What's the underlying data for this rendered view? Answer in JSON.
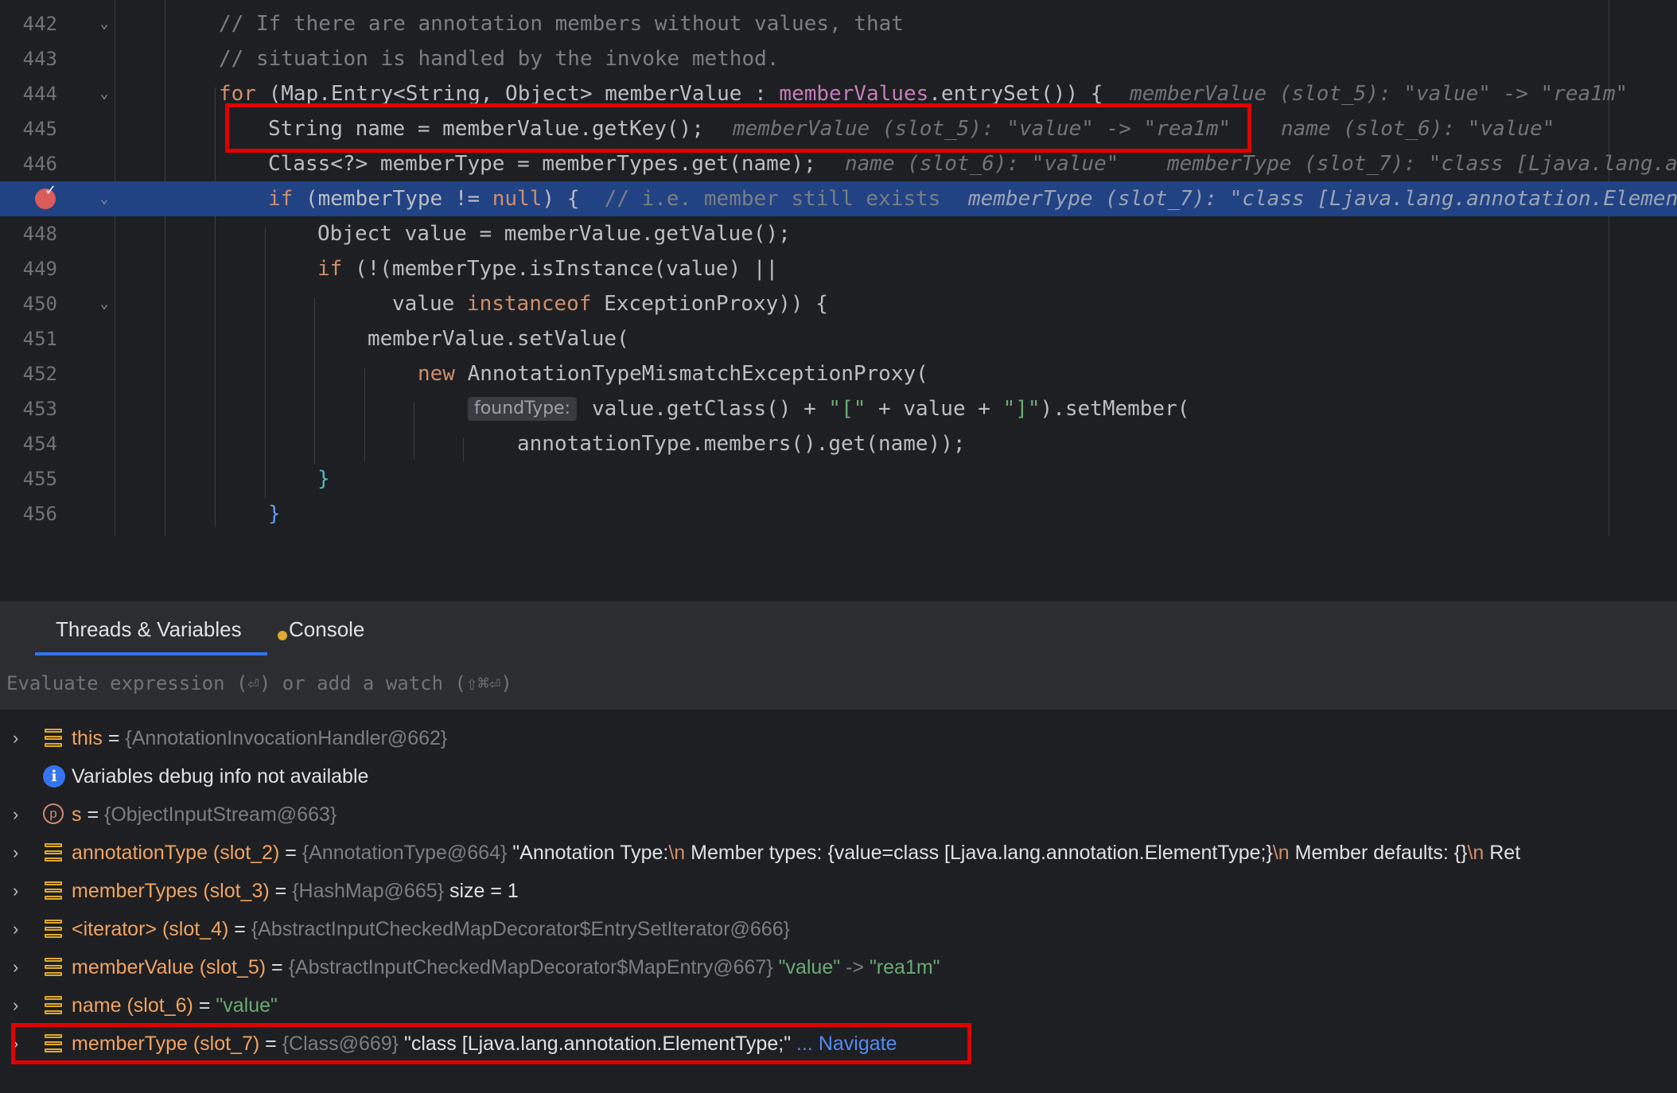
{
  "editor": {
    "lines": [
      {
        "num": "442",
        "code": "// If there are annotation members without values, that"
      },
      {
        "num": "443",
        "code": "// situation is handled by the invoke method."
      },
      {
        "num": "444",
        "code": {
          "kw_for": "for",
          "p1": " (Map.Entry<String, Object> memberValue : ",
          "field": "memberValues",
          "p2": ".entrySet()) {"
        },
        "hint": "memberValue (slot_5): \"value\" -> \"rea1m\""
      },
      {
        "num": "445",
        "code": "String name = memberValue.getKey();",
        "hint1": "memberValue (slot_5): \"value\" -> \"rea1m\"",
        "hint2": "name (slot_6): \"value\""
      },
      {
        "num": "446",
        "code": "Class<?> memberType = memberTypes.get(name);",
        "hint1": "name (slot_6): \"value\"",
        "hint2": "memberType (slot_7): \"class [Ljava.lang.a"
      },
      {
        "num": "447",
        "code": {
          "kw_if": "if",
          "p1": " (memberType != ",
          "kw_null": "null",
          "p2": ") {",
          "comment": "  // i.e. member still exists"
        },
        "hint": "memberType (slot_7): \"class [Ljava.lang.annotation.Elemen"
      },
      {
        "num": "448",
        "code": "Object value = memberValue.getValue();"
      },
      {
        "num": "449",
        "code": {
          "kw_if": "if",
          "p1": " (!(memberType.isInstance(value) ||"
        }
      },
      {
        "num": "450",
        "code": {
          "p1": "value ",
          "kw": "instanceof",
          "p2": " ExceptionProxy)) {"
        }
      },
      {
        "num": "451",
        "code": "memberValue.setValue("
      },
      {
        "num": "452",
        "code": {
          "kw": "new",
          "p1": " AnnotationTypeMismatchExceptionProxy("
        }
      },
      {
        "num": "453",
        "hint_chip": "foundType:",
        "code": {
          "p1": "value.getClass() + ",
          "s1": "\"[\"",
          "p2": " + value + ",
          "s2": "\"]\"",
          "p3": ").setMember("
        }
      },
      {
        "num": "454",
        "code": "annotationType.members().get(name));"
      },
      {
        "num": "455",
        "code": "}"
      },
      {
        "num": "456",
        "code": "}"
      }
    ]
  },
  "debug": {
    "tabs": [
      {
        "label": "Threads & Variables",
        "active": true
      },
      {
        "label": "Console",
        "active": false
      }
    ],
    "evaluate_placeholder": "Evaluate expression (⏎) or add a watch (⇧⌘⏎)",
    "variables": [
      {
        "name": "this",
        "type": "{AnnotationInvocationHandler@662}"
      },
      {
        "info": "Variables debug info not available"
      },
      {
        "name": "s",
        "type": "{ObjectInputStream@663}"
      },
      {
        "name": "annotationType (slot_2)",
        "type": "{AnnotationType@664}",
        "v1": "\"Annotation Type:",
        "nl": "\\n",
        "v2": "   Member types: {value=class [Ljava.lang.annotation.ElementType;}",
        "nl2": "\\n",
        "v3": "   Member defaults: {}",
        "nl3": "\\n",
        "v4": "   Ret"
      },
      {
        "name": "memberTypes (slot_3)",
        "type": "{HashMap@665}",
        "value": "size = 1"
      },
      {
        "name": "<iterator> (slot_4)",
        "type": "{AbstractInputCheckedMapDecorator$EntrySetIterator@666}"
      },
      {
        "name": "memberValue (slot_5)",
        "type": "{AbstractInputCheckedMapDecorator$MapEntry@667}",
        "s1": "\"value\"",
        "arrow": " -> ",
        "s2": "\"rea1m\""
      },
      {
        "name": "name (slot_6)",
        "s1": "\"value\""
      },
      {
        "name": "memberType (slot_7)",
        "type": "{Class@669}",
        "value": "\"class [Ljava.lang.annotation.ElementType;\"",
        "link": "... Navigate"
      }
    ]
  }
}
